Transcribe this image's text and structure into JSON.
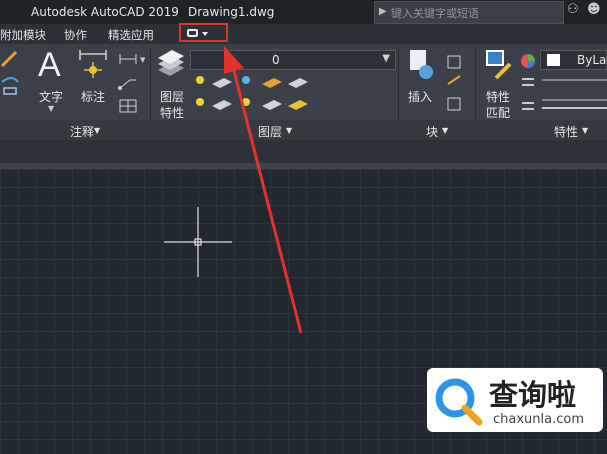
{
  "title_bar": {
    "app_name": "Autodesk AutoCAD 2019",
    "document_name": "Drawing1.dwg",
    "search_placeholder": "键入关键字或短语"
  },
  "ribbon_tabs": [
    "附加模块",
    "协作",
    "精选应用"
  ],
  "ribbon": {
    "annotation_panel": {
      "label": "注释",
      "text_button": "文字",
      "dimension_button": "标注"
    },
    "layers_panel": {
      "label": "图层",
      "layer_properties_button": [
        "图层",
        "特性"
      ],
      "current_layer": "0"
    },
    "block_panel": {
      "label": "块",
      "insert_button": "插入"
    },
    "properties_panel": {
      "label": "特性",
      "match_properties_button": [
        "特性",
        "匹配"
      ],
      "color_value": "ByLay"
    }
  },
  "watermark": {
    "text": "查询啦",
    "url_text": "chaxunla.com"
  },
  "colors": {
    "highlight_red": "#e2322c",
    "canvas_background": "#212830",
    "ribbon_background": "#3b4048"
  }
}
